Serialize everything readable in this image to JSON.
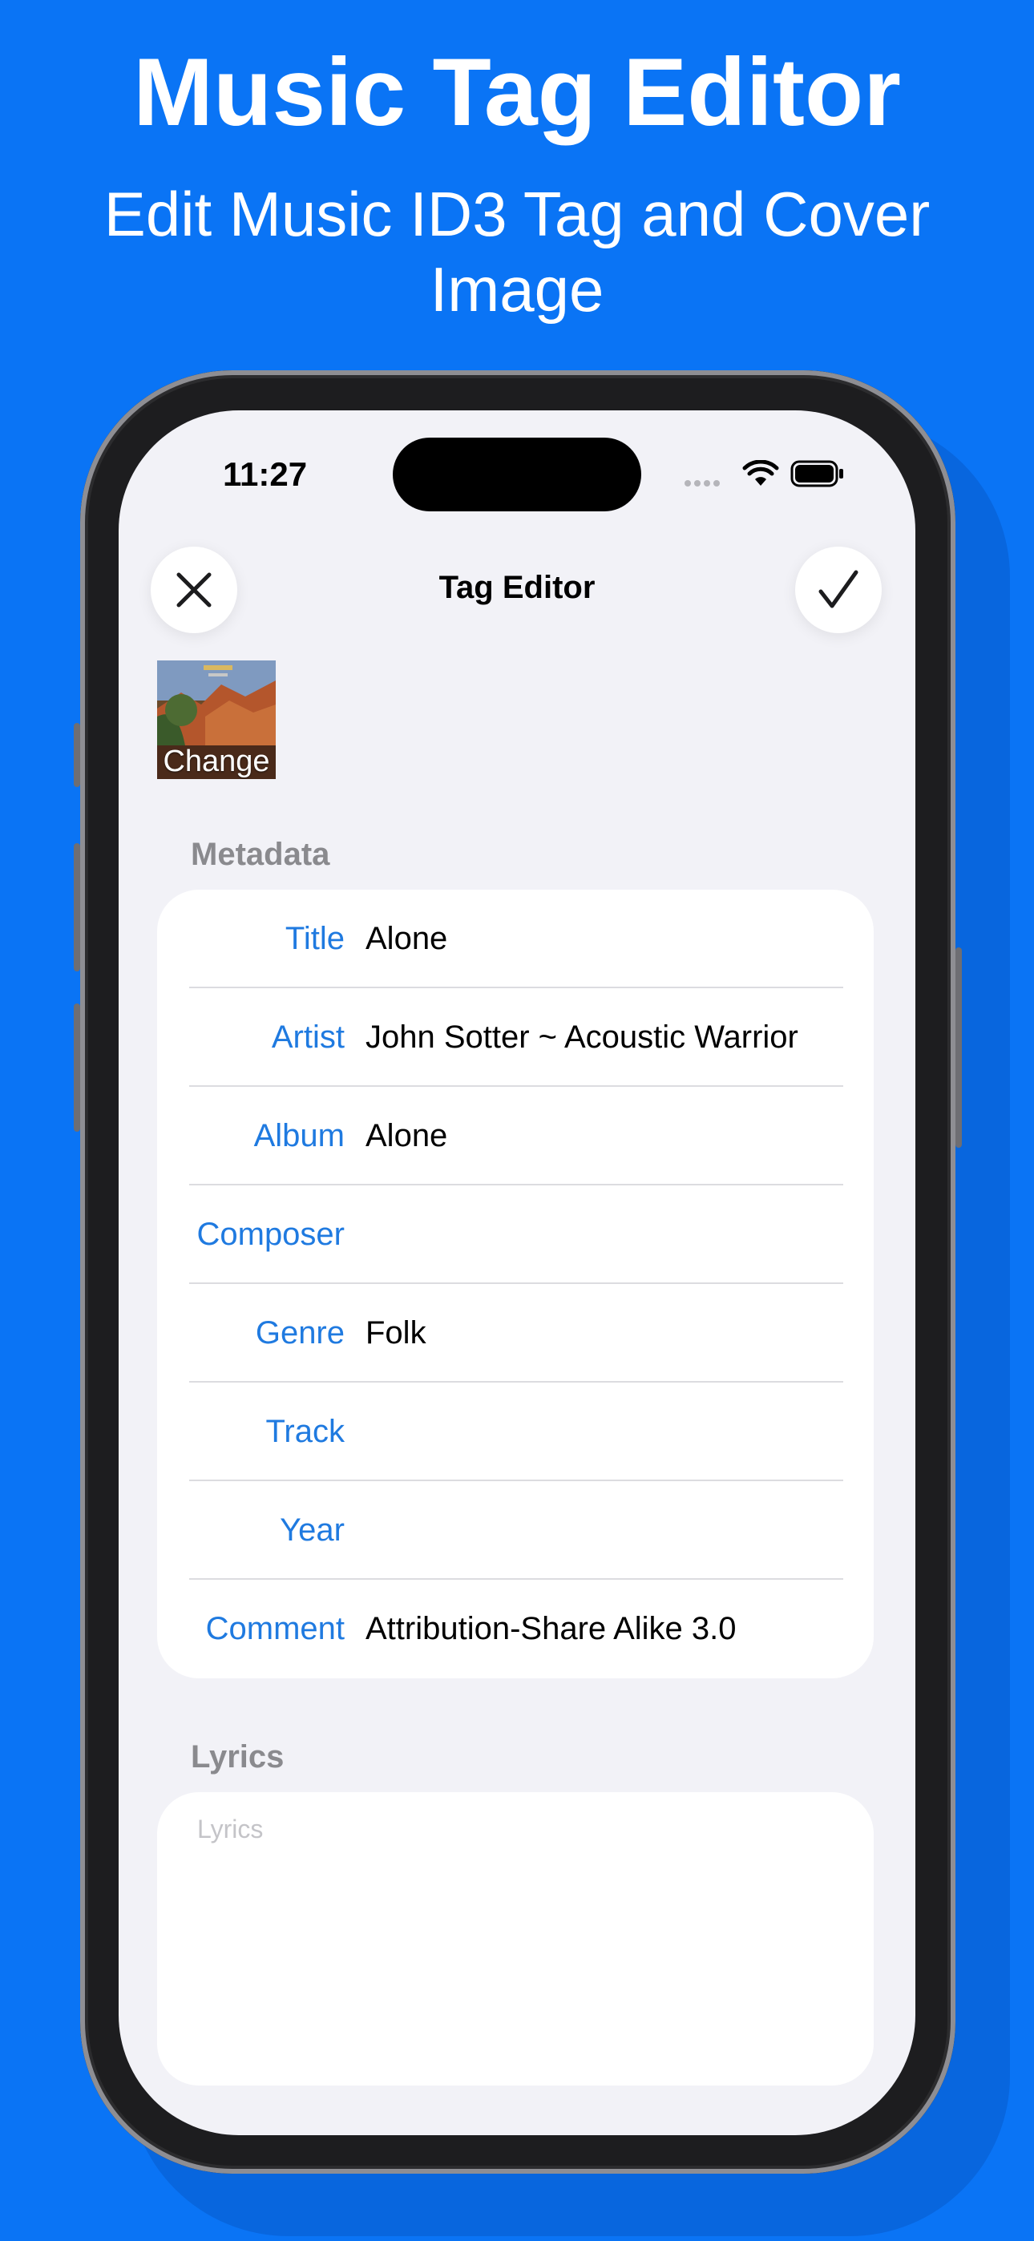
{
  "hero": {
    "title": "Music Tag Editor",
    "subtitle": "Edit Music ID3 Tag and Cover Image"
  },
  "status_bar": {
    "time": "11:27",
    "icons": [
      "signal-icon",
      "wifi-icon",
      "battery-icon"
    ]
  },
  "nav": {
    "title": "Tag Editor",
    "close_icon": "close-icon",
    "confirm_icon": "checkmark-icon"
  },
  "cover": {
    "change_label": "Change"
  },
  "metadata": {
    "header": "Metadata",
    "fields": [
      {
        "label": "Title",
        "value": "Alone"
      },
      {
        "label": "Artist",
        "value": "John Sotter ~ Acoustic Warrior"
      },
      {
        "label": "Album",
        "value": "Alone"
      },
      {
        "label": "Composer",
        "value": ""
      },
      {
        "label": "Genre",
        "value": "Folk"
      },
      {
        "label": "Track",
        "value": ""
      },
      {
        "label": "Year",
        "value": ""
      },
      {
        "label": "Comment",
        "value": "Attribution-Share Alike 3.0"
      }
    ]
  },
  "lyrics": {
    "header": "Lyrics",
    "placeholder": "Lyrics"
  },
  "colors": {
    "background": "#0a74f5",
    "accent": "#1f7ae0",
    "screen": "#f2f2f7"
  }
}
